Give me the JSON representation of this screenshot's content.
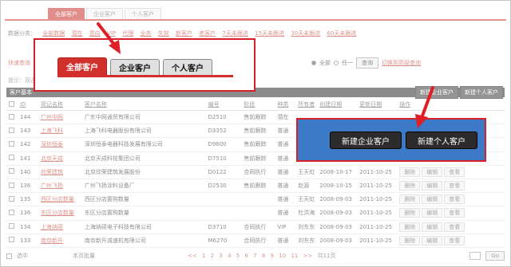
{
  "top_tabs": [
    "全部客户",
    "企业客户",
    "个人客户"
  ],
  "filter": {
    "head": "数据分类：",
    "items": [
      "全部数据",
      "潜在",
      "意向",
      "VIP",
      "代理",
      "业务",
      "失效",
      "新客户",
      "老客户",
      "7天未跟进",
      "15天未跟进",
      "30天未跟进",
      "60天未跟进"
    ]
  },
  "quick": {
    "label": "快速查询",
    "radio_all": "全部",
    "radio_any": "任一",
    "button": "查询",
    "link": "切换到高级查询"
  },
  "hint": "提示：双击",
  "bar_title": "客户基本",
  "bar_buttons": [
    "新建企业客户",
    "新建个人客户"
  ],
  "table": {
    "headers": [
      "ID",
      "简记名称",
      "客户名称",
      "编号",
      "阶段",
      "种类",
      "所有者",
      "创建日期",
      "更新日期",
      "操作"
    ],
    "rows": [
      [
        "144",
        "广州中网",
        "广东中网通贸有限公司",
        "D2510",
        "售前跟踪",
        "潜在",
        "",
        "",
        "",
        ""
      ],
      [
        "143",
        "上海飞科",
        "上海飞科电器股份有限公司",
        "D3352",
        "售前跟踪",
        "普通",
        "",
        "",
        "",
        ""
      ],
      [
        "142",
        "深圳恒泰",
        "深圳恒泰电器科技发展有限公司",
        "D9600",
        "售前跟踪",
        "普通",
        "",
        "",
        "",
        ""
      ],
      [
        "141",
        "北京天成",
        "北京天成科技集团公司",
        "D7510",
        "售前跟踪",
        "普通",
        "",
        "",
        "",
        ""
      ],
      [
        "140",
        "欣荣建筑",
        "北京欣荣建筑发展股份",
        "D0122",
        "合同执行",
        "普通",
        "王天虹",
        "2008-10-17",
        "2011-10-25",
        ""
      ],
      [
        "136",
        "广州飞扬",
        "广州飞扬涂料设备厂",
        "D2530",
        "售前跟踪",
        "普通",
        "赵源",
        "2008-10-15",
        "2011-10-25",
        ""
      ],
      [
        "135",
        "西区分店数量",
        "西区分店置购数量",
        "",
        "",
        "普通",
        "王天虹",
        "2008-09-03",
        "2011-10-25",
        ""
      ],
      [
        "136",
        "东区分店数量",
        "东区分店置购数量",
        "",
        "",
        "普通",
        "杜洪海",
        "2008-09-03",
        "2011-10-25",
        ""
      ],
      [
        "134",
        "上海纳硕",
        "上海纳硕电子科技有限公司",
        "D3710",
        "合同执行",
        "VIP",
        "刘东东",
        "2008-09-03",
        "2011-10-25",
        ""
      ],
      [
        "133",
        "南京新升",
        "南京新升减速机有限公司",
        "M6270",
        "合同执行",
        "普通",
        "刘东东",
        "2008-09-03",
        "2011-10-25",
        ""
      ]
    ],
    "actions": [
      "删除",
      "编辑",
      "查看"
    ]
  },
  "footer": {
    "select_label": "选中",
    "page_label": "本页批量",
    "pages": [
      "<<",
      "1",
      "2",
      "3",
      "4",
      "5",
      "6",
      "7",
      "8",
      "9",
      "10",
      "11",
      ">>"
    ],
    "total": "共11页",
    "go": "Go"
  },
  "callout_tabs": [
    "全部客户",
    "企业客户",
    "个人客户"
  ],
  "callout_buttons": [
    "新建企业客户",
    "新建个人客户"
  ],
  "colors": {
    "accent": "#d2312b",
    "panel_blue": "#3c79c6",
    "dark_button": "#2b2b2b"
  }
}
